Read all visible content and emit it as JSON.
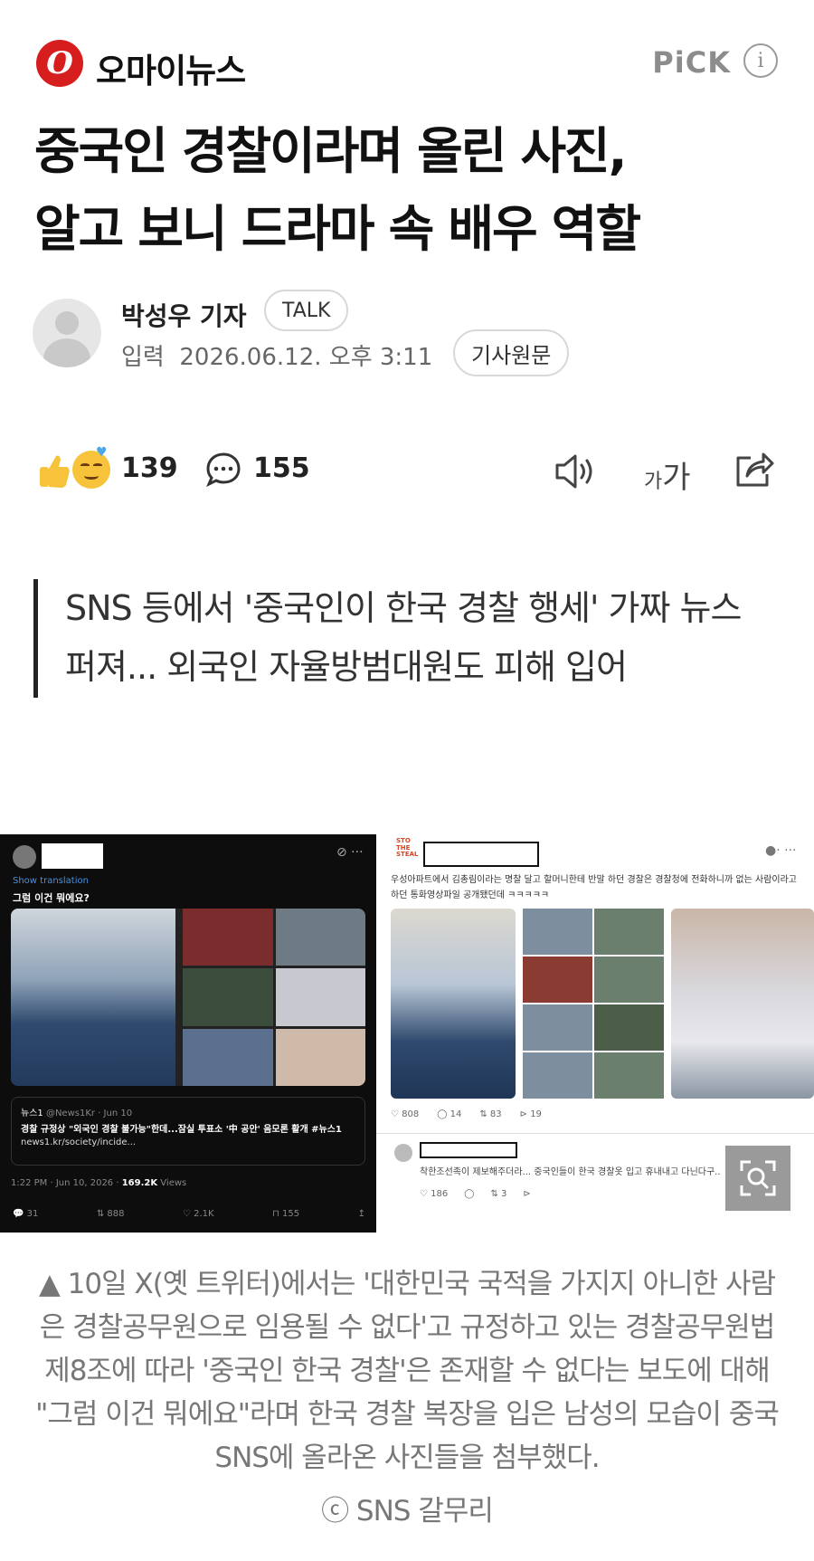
{
  "header": {
    "logo_letter": "O",
    "brand_name": "오마이뉴스",
    "pick_label": "PiCK",
    "info_icon": "info-icon",
    "accent_color": "#d71e1e"
  },
  "article": {
    "headline_line1": "중국인 경찰이라며 올린 사진,",
    "headline_line2": "알고 보니 드라마 속 배우 역할",
    "author_name": "박성우 기자",
    "talk_label": "TALK",
    "date_label": "입력",
    "date_value": "2026.06.12. 오후 3:11",
    "original_label": "기사원문",
    "subtitle": "SNS 등에서 '중국인이 한국 경찰 행세' 가짜 뉴스 퍼져... 외국인 자율방범대원도 피해 입어"
  },
  "reactions": {
    "like_count": "139",
    "comment_count": "155",
    "font_small": "가",
    "font_big": "가"
  },
  "photo": {
    "left_post": {
      "more_icons": "⊘ ···",
      "translate": "Show translation",
      "caption": "그럼 이건 뭐에요?",
      "quote_source": "뉴스1",
      "quote_handle": "@News1Kr · Jun 10",
      "quote_title": "경찰 규정상 \"외국인 경찰 불가능\"한데...잠실 투표소 '中 공안' 음모론 활개 #뉴스1",
      "quote_url": "news1.kr/society/incide...",
      "meta_time": "1:22 PM · Jun 10, 2026 ·",
      "meta_views": "169.2K",
      "meta_views_label": "Views",
      "actions": [
        "💬 31",
        "⇅ 888",
        "♡ 2.1K",
        "⊓ 155",
        "↥"
      ]
    },
    "right_post": {
      "logo_text": "STO THE STEAL",
      "dots": "●· ···",
      "caption": "우성아파트에서 김총림이라는 명찰 달고 할머니한테 반말 하던 경찰은 경찰청에 전화하니까 없는 사람이라고 하던 통화영상파일 공개됐던데 ㅋㅋㅋㅋㅋ",
      "stats": [
        "♡ 808",
        "◯ 14",
        "⇅ 83",
        "⊳ 19"
      ],
      "reply_text": "착한조선족이 제보해주더라... 중국인들이 한국 경찰옷 입고 휴내내고 다닌다구..",
      "reply_stats": [
        "♡ 186",
        "◯",
        "⇅ 3",
        "⊳"
      ]
    }
  },
  "caption": {
    "text": "▲ 10일 X(옛 트위터)에서는 '대한민국 국적을 가지지 아니한 사람은 경찰공무원으로 임용될 수 없다'고 규정하고 있는 경찰공무원법 제8조에 따라 '중국인 한국 경찰'은 존재할 수 없다는 보도에 대해 \"그럼 이건 뭐에요\"라며 한국 경찰 복장을 입은 남성의 모습이 중국 SNS에 올라온 사진들을 첨부했다.",
    "credit": "ⓒ SNS 갈무리"
  }
}
